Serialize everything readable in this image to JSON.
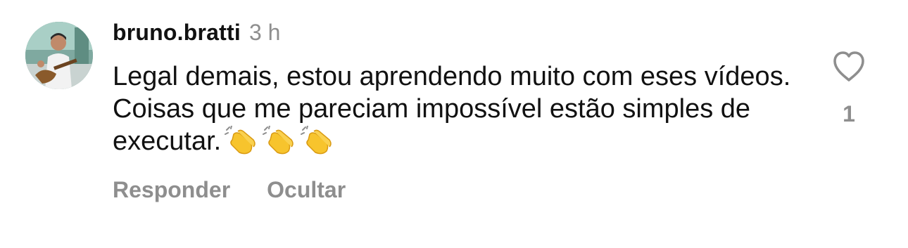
{
  "comment": {
    "username": "bruno.bratti",
    "timestamp": "3 h",
    "text": "Legal demais, estou aprendendo muito com eses vídeos. Coisas que me pareciam impossível estão simples de executar.",
    "emoji_icons": [
      "clapping-hands-icon",
      "clapping-hands-icon",
      "clapping-hands-icon"
    ]
  },
  "actions": {
    "reply_label": "Responder",
    "hide_label": "Ocultar"
  },
  "like": {
    "icon": "heart-outline-icon",
    "count": "1"
  },
  "colors": {
    "text_primary": "#111111",
    "text_secondary": "#8e8e8e",
    "background": "#ffffff",
    "emoji_yellow": "#f7c42d"
  }
}
